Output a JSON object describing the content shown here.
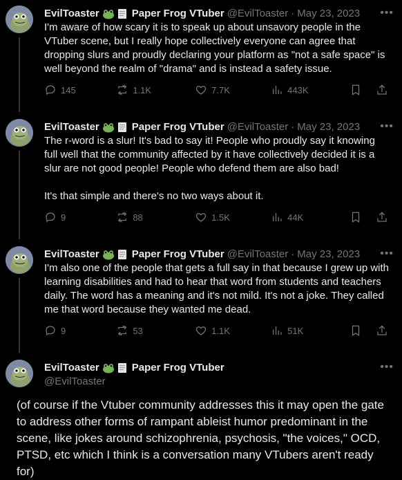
{
  "tweets": [
    {
      "name": "EvilToaster",
      "badge_text": "Paper Frog VTuber",
      "handle": "@EvilToaster",
      "date": "May 23, 2023",
      "text": "I'm aware of how scary it is to speak up about unsavory people in the VTuber scene, but I really hope collectively everyone can agree that dropping slurs and proudly declaring your platform as \"not a safe space\" is well beyond the realm of \"drama\" and is instead a safety issue.",
      "replies": "145",
      "reposts": "1.1K",
      "likes": "7.7K",
      "views": "443K"
    },
    {
      "name": "EvilToaster",
      "badge_text": "Paper Frog VTuber",
      "handle": "@EvilToaster",
      "date": "May 23, 2023",
      "text": "The r-word is a slur! It's bad to say it! People who proudly say it knowing full well that the community affected by it have collectively decided it is a slur are not good people! People who defend them are also bad!\n\nIt's that simple and there's no two ways about it.",
      "replies": "9",
      "reposts": "88",
      "likes": "1.5K",
      "views": "44K"
    },
    {
      "name": "EvilToaster",
      "badge_text": "Paper Frog VTuber",
      "handle": "@EvilToaster",
      "date": "May 23, 2023",
      "text": "I'm also one of the people that gets a full say in that because I grew up with learning disabilities and had to hear that word from students and teachers daily. The word has a meaning and it's not mild. It's not a joke. They called me that word because they wanted me dead.",
      "replies": "9",
      "reposts": "53",
      "likes": "1.1K",
      "views": "51K"
    }
  ],
  "last": {
    "name": "EvilToaster",
    "badge_text": "Paper Frog VTuber",
    "handle": "@EvilToaster",
    "text": "(of course if the Vtuber community addresses this it may open the gate to address other forms of rampant ableist humor predominant in the scene, like jokes around schizophrenia, psychosis, \"the voices,\" OCD, PTSD, etc which I think is a conversation many VTubers aren't ready for)"
  },
  "icons": {
    "more": "more-dots-icon",
    "reply": "reply-icon",
    "repost": "repost-icon",
    "like": "heart-icon",
    "views": "views-chart-icon",
    "bookmark": "bookmark-icon",
    "share": "share-icon",
    "emoji1": "frog-emoji-icon",
    "emoji2": "page-emoji-icon"
  },
  "colors": {
    "background": "#000000",
    "text": "#e7e9ea",
    "secondary": "#71767b",
    "thread_line": "#333639"
  }
}
